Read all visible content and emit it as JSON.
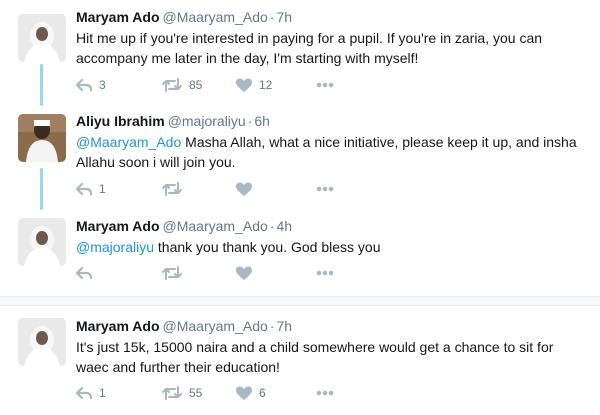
{
  "tweets": [
    {
      "name": "Maryam Ado",
      "handle": "@Maaryam_Ado",
      "time": "7h",
      "text": "Hit me up if you're interested in paying for a pupil. If you're in zaria, you can accompany me later in the day, I'm starting with myself!",
      "replies": "3",
      "retweets": "85",
      "likes": "12"
    },
    {
      "name": "Aliyu Ibrahim",
      "handle": "@majoraliyu",
      "time": "6h",
      "mention": "@Maaryam_Ado",
      "text": " Masha Allah, what a nice initiative, please keep it up, and insha Allahu soon i will join you.",
      "replies": "1",
      "retweets": "",
      "likes": ""
    },
    {
      "name": "Maryam Ado",
      "handle": "@Maaryam_Ado",
      "time": "4h",
      "mention": "@majoraliyu",
      "text": " thank you thank you. God bless you",
      "replies": "",
      "retweets": "",
      "likes": ""
    },
    {
      "name": "Maryam Ado",
      "handle": "@Maaryam_Ado",
      "time": "7h",
      "text": "It's just 15k, 15000 naira and a child somewhere would get a chance to sit for waec and further their education!",
      "replies": "1",
      "retweets": "55",
      "likes": "6"
    }
  ],
  "dot": "·",
  "icons": {
    "reply": "reply-arrow-icon",
    "retweet": "retweet-icon",
    "like": "heart-icon",
    "more": "more-dots-icon"
  },
  "colors": {
    "name": "#14171a",
    "meta": "#657786",
    "mention": "#1b95e0",
    "icon": "#aab8c2",
    "thread_line": "#9fd6ee"
  }
}
